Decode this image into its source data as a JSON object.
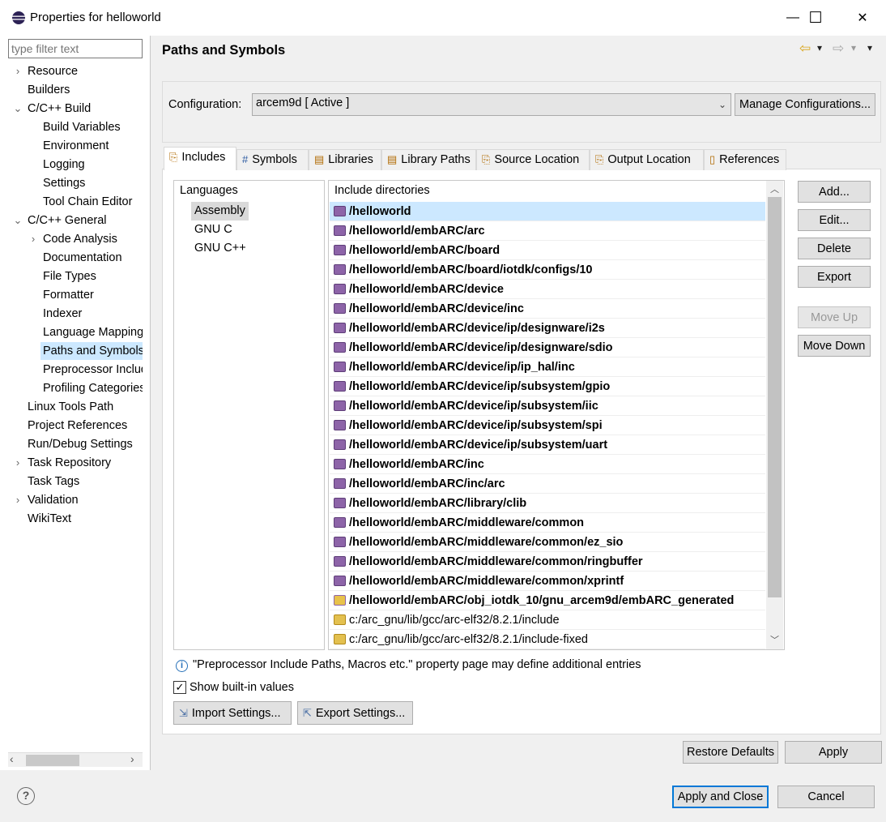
{
  "window": {
    "title": "Properties for helloworld",
    "minimize": "—",
    "maximize": "☐",
    "close": "✕"
  },
  "filter": {
    "placeholder": "type filter text"
  },
  "tree": [
    {
      "label": "Resource",
      "chev": "›"
    },
    {
      "label": "Builders",
      "chev": ""
    },
    {
      "label": "C/C++ Build",
      "chev": "⌄"
    },
    {
      "label": "Build Variables",
      "chev": ""
    },
    {
      "label": "Environment",
      "chev": ""
    },
    {
      "label": "Logging",
      "chev": ""
    },
    {
      "label": "Settings",
      "chev": ""
    },
    {
      "label": "Tool Chain Editor",
      "chev": ""
    },
    {
      "label": "C/C++ General",
      "chev": "⌄"
    },
    {
      "label": "Code Analysis",
      "chev": "›"
    },
    {
      "label": "Documentation",
      "chev": ""
    },
    {
      "label": "File Types",
      "chev": ""
    },
    {
      "label": "Formatter",
      "chev": ""
    },
    {
      "label": "Indexer",
      "chev": ""
    },
    {
      "label": "Language Mappings",
      "chev": ""
    },
    {
      "label": "Paths and Symbols",
      "chev": ""
    },
    {
      "label": "Preprocessor Include Paths",
      "chev": ""
    },
    {
      "label": "Profiling Categories",
      "chev": ""
    },
    {
      "label": "Linux Tools Path",
      "chev": ""
    },
    {
      "label": "Project References",
      "chev": ""
    },
    {
      "label": "Run/Debug Settings",
      "chev": ""
    },
    {
      "label": "Task Repository",
      "chev": "›"
    },
    {
      "label": "Task Tags",
      "chev": ""
    },
    {
      "label": "Validation",
      "chev": "›"
    },
    {
      "label": "WikiText",
      "chev": ""
    }
  ],
  "page_title": "Paths and Symbols",
  "nav": {
    "back": "⇦",
    "forward": "⇨",
    "dropdown": "▾",
    "menu": "▾"
  },
  "configuration": {
    "label": "Configuration:",
    "value": "arcem9d  [ Active ]",
    "manage_button": "Manage Configurations..."
  },
  "tabs": [
    {
      "label": "Includes",
      "icon": "⎘"
    },
    {
      "label": "Symbols",
      "icon": "#"
    },
    {
      "label": "Libraries",
      "icon": "▤"
    },
    {
      "label": "Library Paths",
      "icon": "▤"
    },
    {
      "label": "Source Location",
      "icon": "⎘"
    },
    {
      "label": "Output Location",
      "icon": "⎘"
    },
    {
      "label": "References",
      "icon": "▯"
    }
  ],
  "languages": {
    "header": "Languages",
    "items": [
      "Assembly",
      "GNU C",
      "GNU C++"
    ]
  },
  "include_dirs": {
    "header": "Include directories",
    "items": [
      {
        "path": "/helloworld",
        "kind": "ws"
      },
      {
        "path": "/helloworld/embARC/arc",
        "kind": "ws"
      },
      {
        "path": "/helloworld/embARC/board",
        "kind": "ws"
      },
      {
        "path": "/helloworld/embARC/board/iotdk/configs/10",
        "kind": "ws"
      },
      {
        "path": "/helloworld/embARC/device",
        "kind": "ws"
      },
      {
        "path": "/helloworld/embARC/device/inc",
        "kind": "ws"
      },
      {
        "path": "/helloworld/embARC/device/ip/designware/i2s",
        "kind": "ws"
      },
      {
        "path": "/helloworld/embARC/device/ip/designware/sdio",
        "kind": "ws"
      },
      {
        "path": "/helloworld/embARC/device/ip/ip_hal/inc",
        "kind": "ws"
      },
      {
        "path": "/helloworld/embARC/device/ip/subsystem/gpio",
        "kind": "ws"
      },
      {
        "path": "/helloworld/embARC/device/ip/subsystem/iic",
        "kind": "ws"
      },
      {
        "path": "/helloworld/embARC/device/ip/subsystem/spi",
        "kind": "ws"
      },
      {
        "path": "/helloworld/embARC/device/ip/subsystem/uart",
        "kind": "ws"
      },
      {
        "path": "/helloworld/embARC/inc",
        "kind": "ws"
      },
      {
        "path": "/helloworld/embARC/inc/arc",
        "kind": "ws"
      },
      {
        "path": "/helloworld/embARC/library/clib",
        "kind": "ws"
      },
      {
        "path": "/helloworld/embARC/middleware/common",
        "kind": "ws"
      },
      {
        "path": "/helloworld/embARC/middleware/common/ez_sio",
        "kind": "ws"
      },
      {
        "path": "/helloworld/embARC/middleware/common/ringbuffer",
        "kind": "ws"
      },
      {
        "path": "/helloworld/embARC/middleware/common/xprintf",
        "kind": "ws"
      },
      {
        "path": "/helloworld/embARC/obj_iotdk_10/gnu_arcem9d/embARC_generated",
        "kind": "gen"
      },
      {
        "path": "c:/arc_gnu/lib/gcc/arc-elf32/8.2.1/include",
        "kind": "fs"
      },
      {
        "path": "c:/arc_gnu/lib/gcc/arc-elf32/8.2.1/include-fixed",
        "kind": "fs"
      }
    ]
  },
  "side_buttons": {
    "add": "Add...",
    "edit": "Edit...",
    "delete": "Delete",
    "export": "Export",
    "move_up": "Move Up",
    "move_down": "Move Down"
  },
  "info_text": "\"Preprocessor Include Paths, Macros etc.\" property page may define additional entries",
  "show_builtin": {
    "label": "Show built-in values",
    "checked": "✓"
  },
  "import_settings": "Import Settings...",
  "export_settings": "Export Settings...",
  "restore_defaults": "Restore Defaults",
  "apply": "Apply",
  "apply_and_close": "Apply and Close",
  "cancel": "Cancel",
  "help": "?"
}
